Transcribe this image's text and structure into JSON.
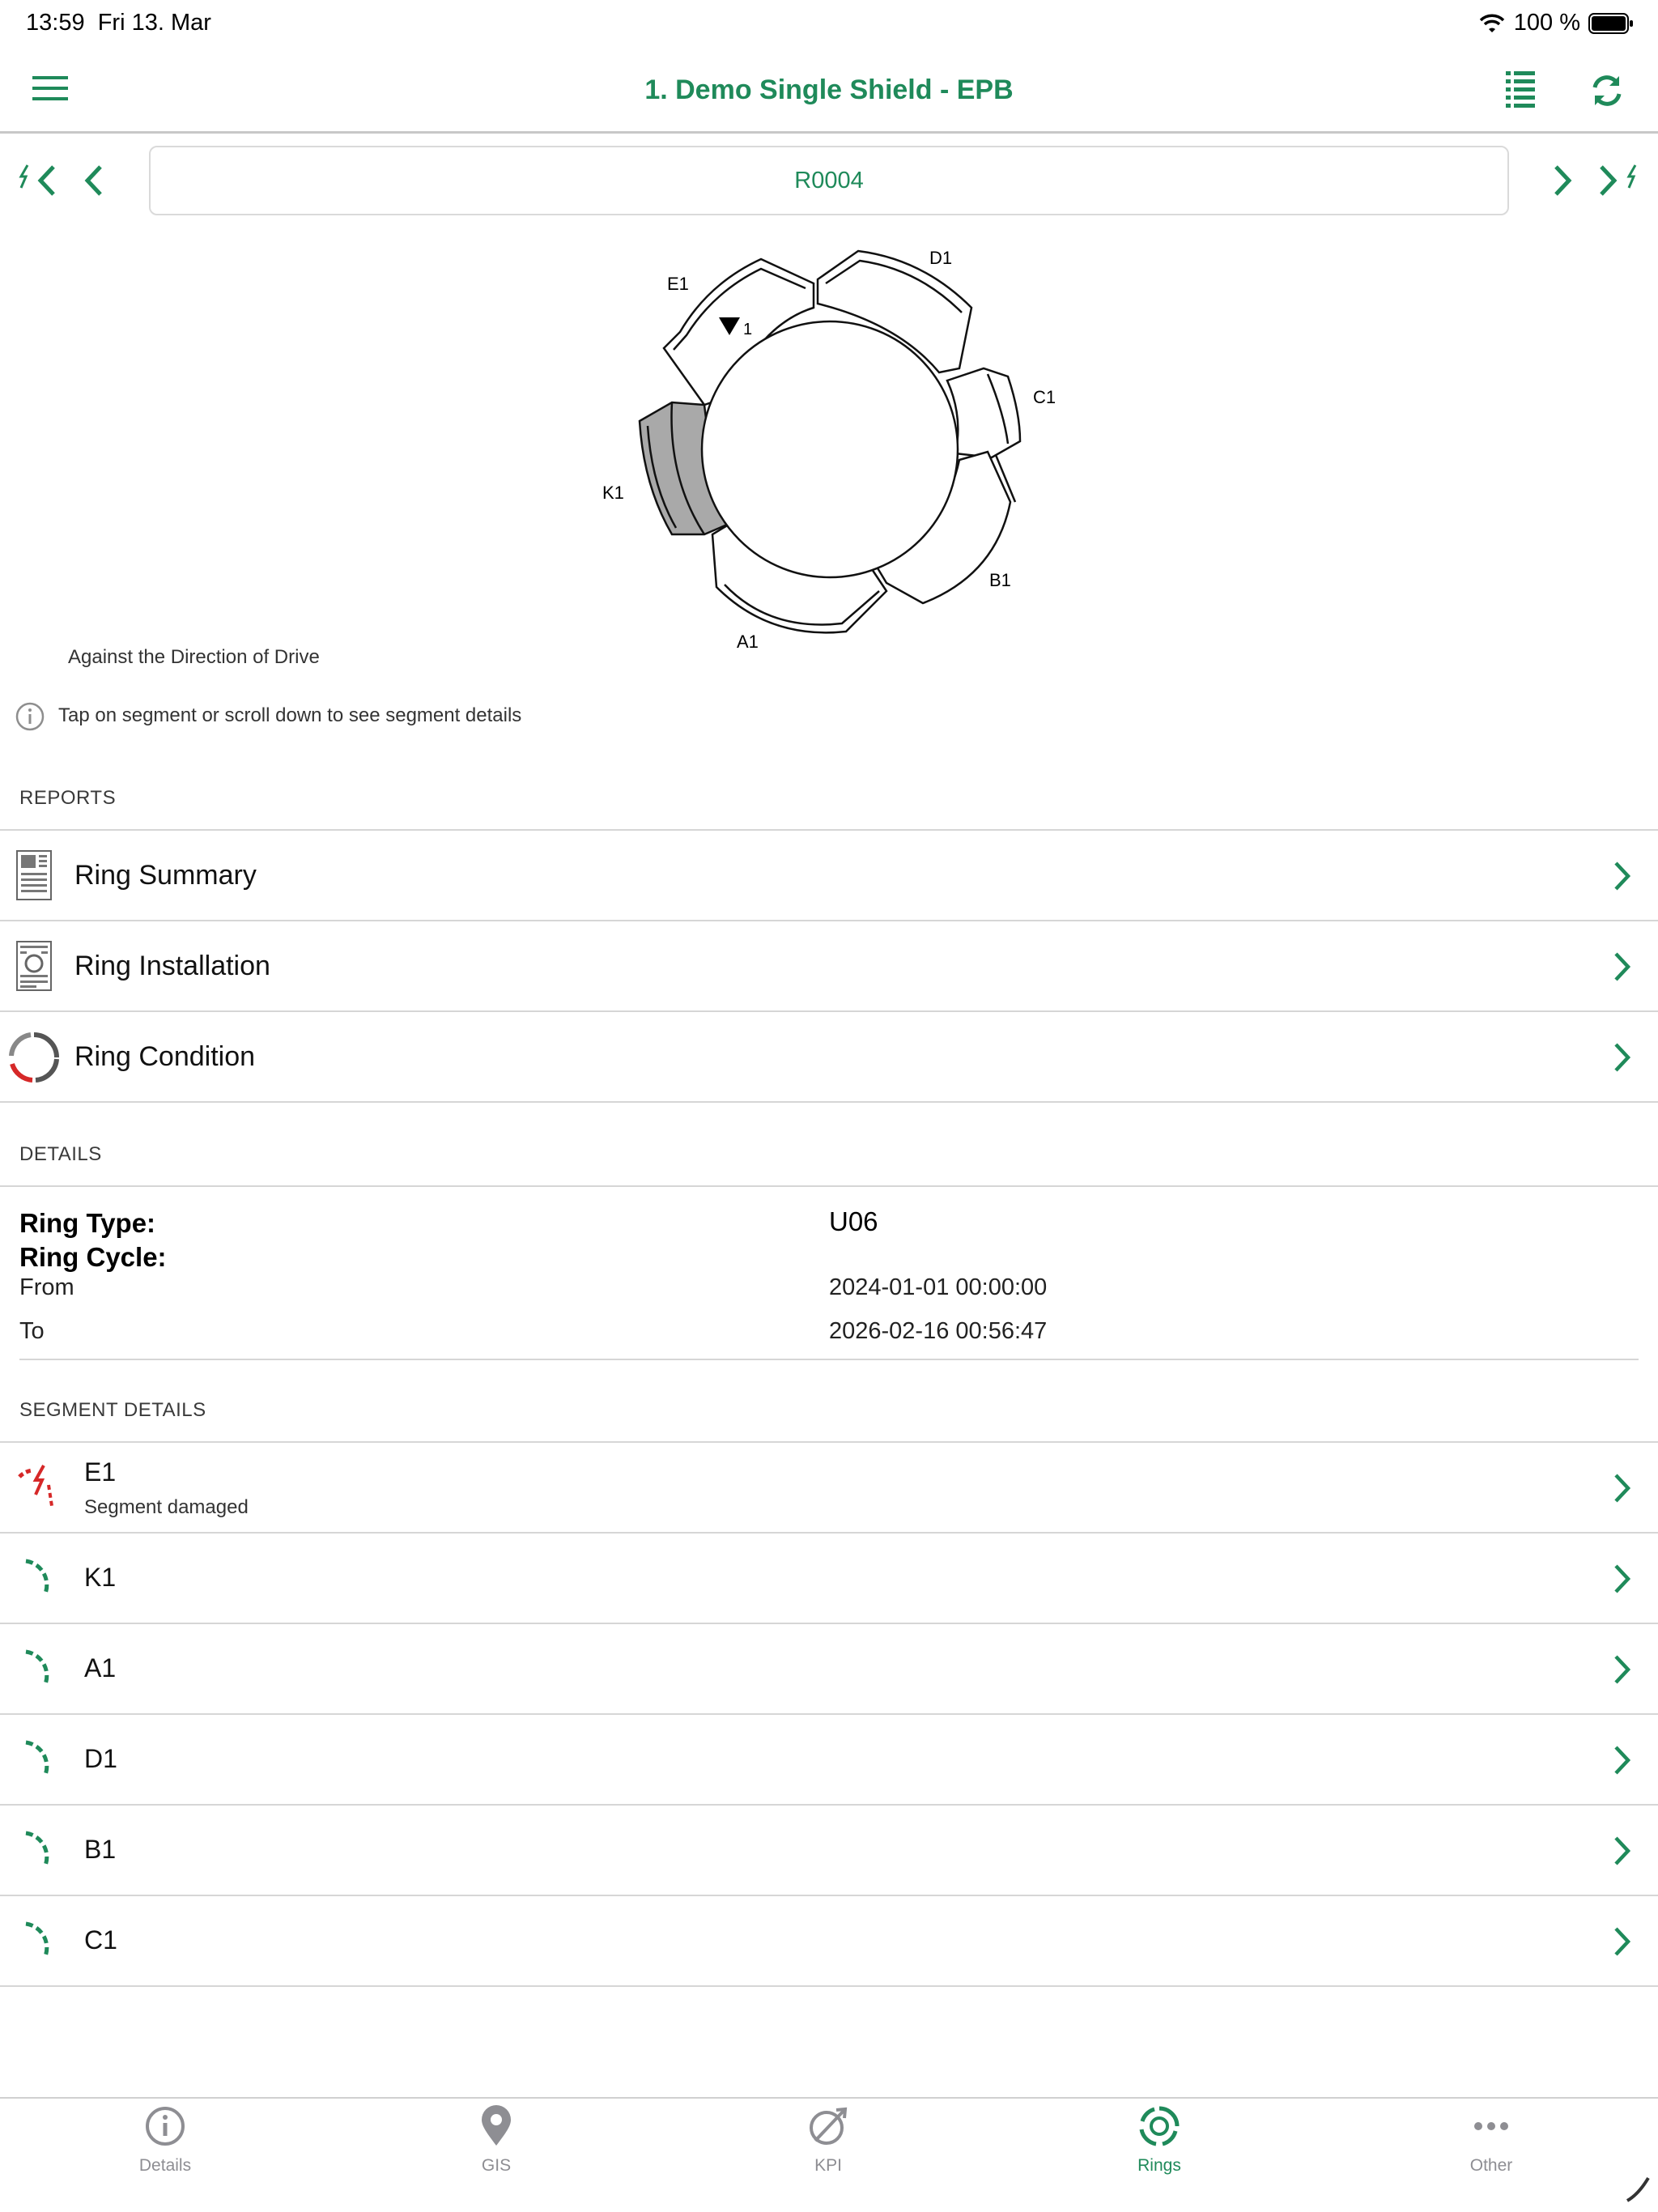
{
  "status_bar": {
    "time": "13:59",
    "date": "Fri 13. Mar",
    "battery": "100 %"
  },
  "nav": {
    "title": "1. Demo Single Shield - EPB"
  },
  "ring_selector": {
    "ring_id": "R0004"
  },
  "diagram": {
    "segments": [
      "E1",
      "D1",
      "C1",
      "B1",
      "A1",
      "K1"
    ],
    "marker_label": "1",
    "caption": "Against the Direction of Drive"
  },
  "info_hint": "Tap on segment or scroll down to see segment details",
  "reports": {
    "header": "REPORTS",
    "items": [
      {
        "label": "Ring Summary"
      },
      {
        "label": "Ring Installation"
      },
      {
        "label": "Ring Condition"
      }
    ]
  },
  "details": {
    "header": "DETAILS",
    "ring_type_label": "Ring Type:",
    "ring_type_value": "U06",
    "ring_cycle_label": "Ring Cycle:",
    "from_label": "From",
    "from_value": "2024-01-01 00:00:00",
    "to_label": "To",
    "to_value": "2026-02-16 00:56:47"
  },
  "segment_details": {
    "header": "SEGMENT DETAILS",
    "items": [
      {
        "name": "E1",
        "status": "Segment damaged"
      },
      {
        "name": "K1"
      },
      {
        "name": "A1"
      },
      {
        "name": "D1"
      },
      {
        "name": "B1"
      },
      {
        "name": "C1"
      }
    ]
  },
  "tabs": [
    {
      "label": "Details",
      "icon": "info-icon"
    },
    {
      "label": "GIS",
      "icon": "map-pin-icon"
    },
    {
      "label": "KPI",
      "icon": "kpi-icon"
    },
    {
      "label": "Rings",
      "icon": "rings-icon",
      "active": true
    },
    {
      "label": "Other",
      "icon": "more-icon"
    }
  ],
  "colors": {
    "accent": "#1f8a5a",
    "danger": "#d62828",
    "key_segment": "#a9a9a9"
  }
}
